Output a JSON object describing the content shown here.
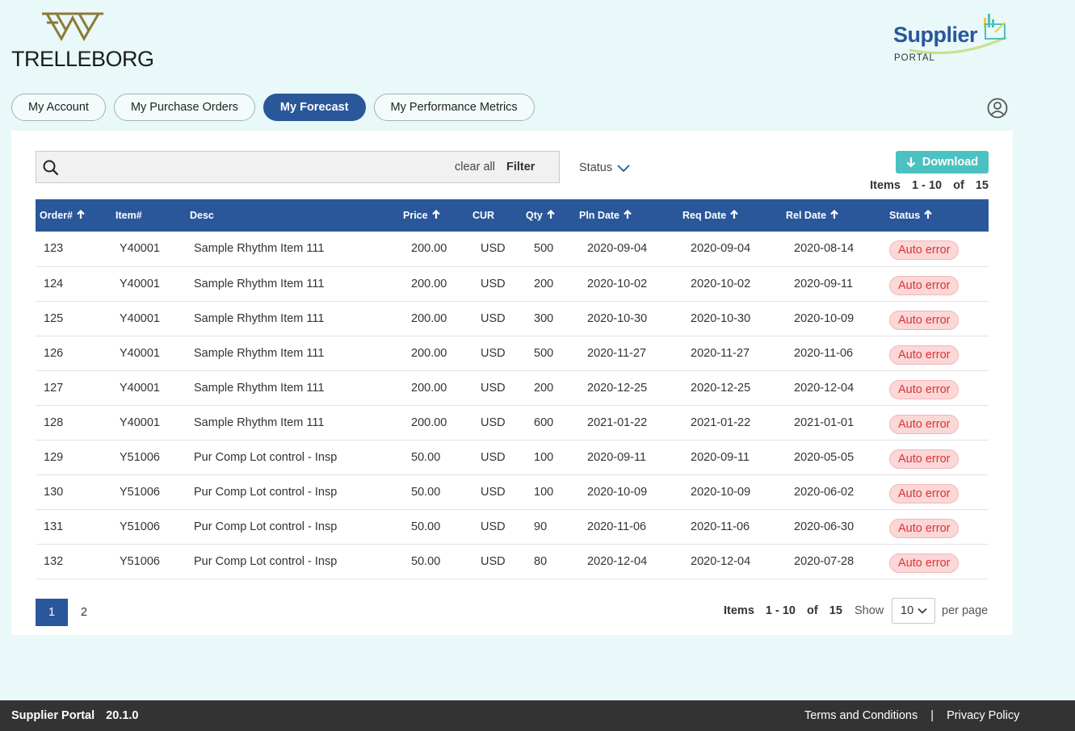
{
  "header": {
    "brand": "TRELLEBORG",
    "portal_title": "Supplier",
    "portal_sub": "PORTAL"
  },
  "tabs": [
    {
      "label": "My Account",
      "active": false
    },
    {
      "label": "My Purchase Orders",
      "active": false
    },
    {
      "label": "My Forecast",
      "active": true
    },
    {
      "label": "My Performance Metrics",
      "active": false
    }
  ],
  "toolbar": {
    "search_placeholder": "",
    "clear_all": "clear all",
    "filter": "Filter",
    "status": "Status",
    "download": "Download"
  },
  "summary": {
    "items_label": "Items",
    "range": "1 - 10",
    "of": "of",
    "total": "15"
  },
  "table": {
    "headers": [
      "Order#",
      "Item#",
      "Desc",
      "Price",
      "CUR",
      "Qty",
      "Pln Date",
      "Req Date",
      "Rel Date",
      "Status"
    ],
    "rows": [
      [
        "123",
        "Y40001",
        "Sample Rhythm Item 111",
        "200.00",
        "USD",
        "500",
        "2020-09-04",
        "2020-09-04",
        "2020-08-14",
        "Auto error"
      ],
      [
        "124",
        "Y40001",
        "Sample Rhythm Item 111",
        "200.00",
        "USD",
        "200",
        "2020-10-02",
        "2020-10-02",
        "2020-09-11",
        "Auto error"
      ],
      [
        "125",
        "Y40001",
        "Sample Rhythm Item 111",
        "200.00",
        "USD",
        "300",
        "2020-10-30",
        "2020-10-30",
        "2020-10-09",
        "Auto error"
      ],
      [
        "126",
        "Y40001",
        "Sample Rhythm Item 111",
        "200.00",
        "USD",
        "500",
        "2020-11-27",
        "2020-11-27",
        "2020-11-06",
        "Auto error"
      ],
      [
        "127",
        "Y40001",
        "Sample Rhythm Item 111",
        "200.00",
        "USD",
        "200",
        "2020-12-25",
        "2020-12-25",
        "2020-12-04",
        "Auto error"
      ],
      [
        "128",
        "Y40001",
        "Sample Rhythm Item 111",
        "200.00",
        "USD",
        "600",
        "2021-01-22",
        "2021-01-22",
        "2021-01-01",
        "Auto error"
      ],
      [
        "129",
        "Y51006",
        "Pur Comp Lot control - Insp",
        "50.00",
        "USD",
        "100",
        "2020-09-11",
        "2020-09-11",
        "2020-05-05",
        "Auto error"
      ],
      [
        "130",
        "Y51006",
        "Pur Comp Lot control - Insp",
        "50.00",
        "USD",
        "100",
        "2020-10-09",
        "2020-10-09",
        "2020-06-02",
        "Auto error"
      ],
      [
        "131",
        "Y51006",
        "Pur Comp Lot control - Insp",
        "50.00",
        "USD",
        "90",
        "2020-11-06",
        "2020-11-06",
        "2020-06-30",
        "Auto error"
      ],
      [
        "132",
        "Y51006",
        "Pur Comp Lot control - Insp",
        "50.00",
        "USD",
        "80",
        "2020-12-04",
        "2020-12-04",
        "2020-07-28",
        "Auto error"
      ]
    ]
  },
  "pagination": {
    "pages": [
      "1",
      "2"
    ],
    "current": "1",
    "show": "Show",
    "per_page_value": "10",
    "per_page": "per page"
  },
  "footer": {
    "app_name": "Supplier Portal",
    "version": "20.1.0",
    "terms": "Terms and Conditions",
    "separator": "|",
    "privacy": "Privacy Policy"
  },
  "colors": {
    "primary": "#2a579a",
    "accent": "#4cc1c1",
    "error_bg": "#fbd7d7",
    "error_text": "#d33"
  }
}
